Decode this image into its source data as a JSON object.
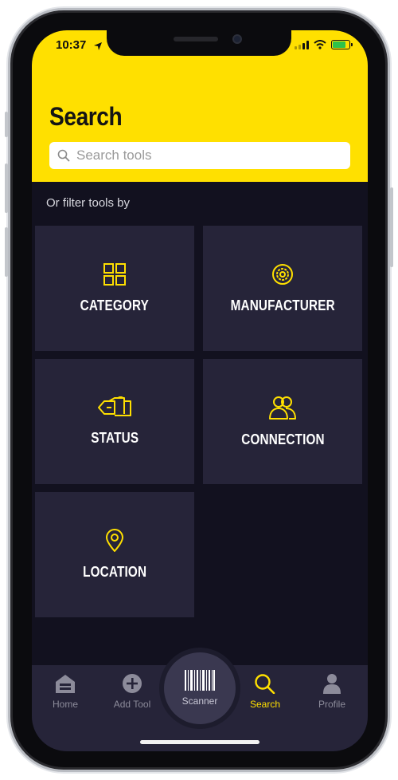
{
  "status_bar": {
    "time": "10:37"
  },
  "header": {
    "title": "Search"
  },
  "search": {
    "placeholder": "Search tools"
  },
  "filter": {
    "label": "Or filter tools by",
    "tiles": [
      {
        "label": "CATEGORY",
        "icon": "grid-icon"
      },
      {
        "label": "MANUFACTURER",
        "icon": "gear-icon"
      },
      {
        "label": "STATUS",
        "icon": "status-tags-icon"
      },
      {
        "label": "CONNECTION",
        "icon": "users-icon"
      },
      {
        "label": "LOCATION",
        "icon": "location-pin-icon"
      }
    ]
  },
  "tabbar": {
    "items": [
      {
        "label": "Home",
        "icon": "garage-icon"
      },
      {
        "label": "Add Tool",
        "icon": "plus-circle-icon"
      },
      {
        "label": "Scanner",
        "icon": "barcode-icon"
      },
      {
        "label": "Search",
        "icon": "search-icon",
        "active": true
      },
      {
        "label": "Profile",
        "icon": "person-icon"
      }
    ]
  },
  "colors": {
    "accent": "#ffe000",
    "background": "#12111f",
    "tile": "#262439",
    "inactive": "#8c8b9a"
  }
}
